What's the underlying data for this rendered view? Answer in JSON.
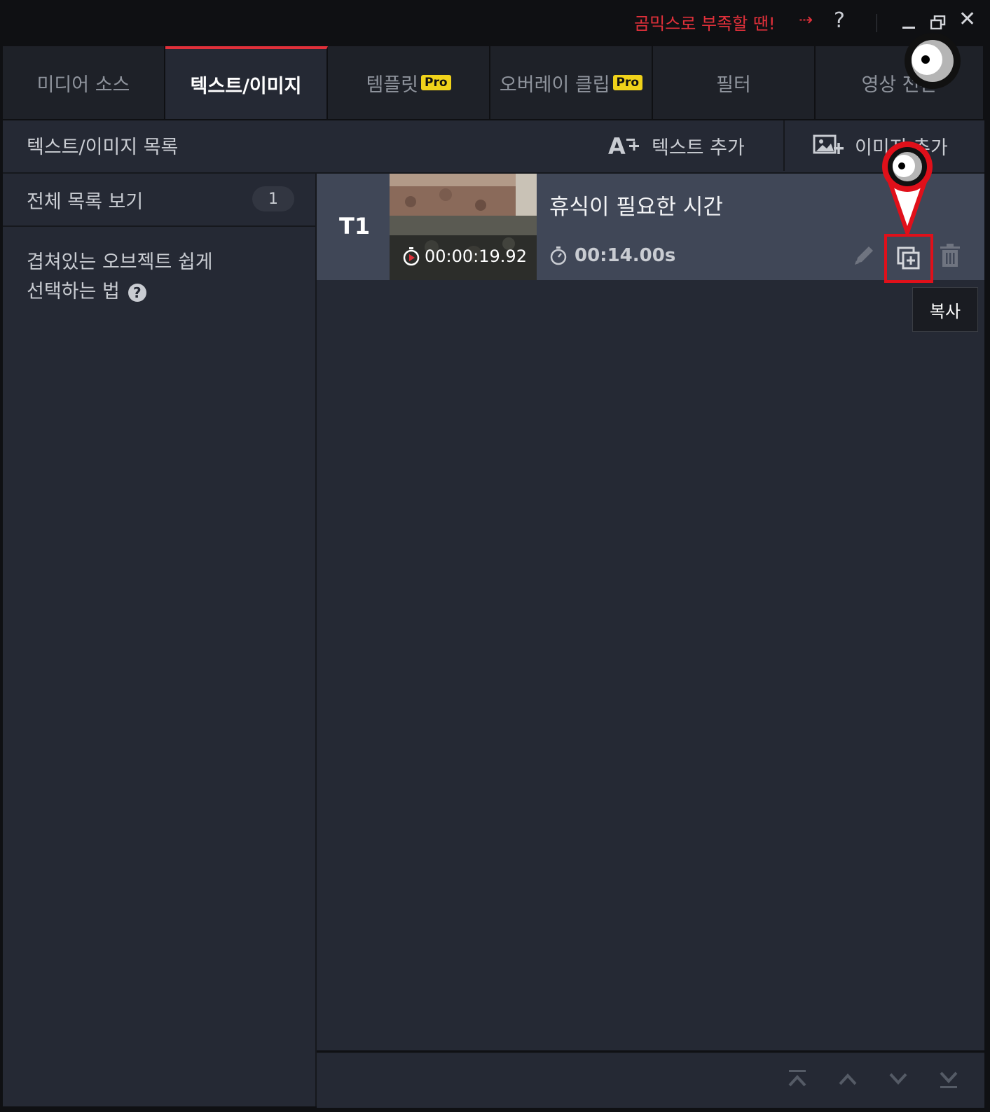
{
  "titlebar": {
    "promo_text": "곰믹스로 부족할 땐!",
    "promo_arrow": "⇢",
    "help_label": "?",
    "close_label": "✕"
  },
  "tabs": [
    {
      "label": "미디어 소스",
      "pro": false
    },
    {
      "label": "텍스트/이미지",
      "pro": false,
      "active": true
    },
    {
      "label": "템플릿",
      "pro": true
    },
    {
      "label": "오버레이 클립",
      "pro": true
    },
    {
      "label": "필터",
      "pro": false
    },
    {
      "label": "영상 전환",
      "pro": false
    }
  ],
  "pro_badge": "Pro",
  "toolbar": {
    "list_title": "텍스트/이미지 목록",
    "add_text_label": "텍스트 추가",
    "add_image_label": "이미지 추가"
  },
  "sidebar": {
    "all_list_label": "전체 목록 보기",
    "all_list_count": "1",
    "tip_line1": "겹쳐있는 오브젝트 쉽게",
    "tip_line2": "선택하는 법",
    "help_icon": "?"
  },
  "items": [
    {
      "id": "T1",
      "title": "휴식이 필요한 시간",
      "start_time": "00:00:19.92",
      "duration": "00:14.00s"
    }
  ],
  "tooltip": "복사",
  "icons": {
    "edit": "pencil-icon",
    "copy": "copy-icon",
    "delete": "trash-icon",
    "nav": [
      "move-top-icon",
      "move-up-icon",
      "move-down-icon",
      "move-bottom-icon"
    ]
  },
  "colors": {
    "accent": "#e0303a",
    "highlight": "#e0101a",
    "pro": "#f0d21a"
  }
}
